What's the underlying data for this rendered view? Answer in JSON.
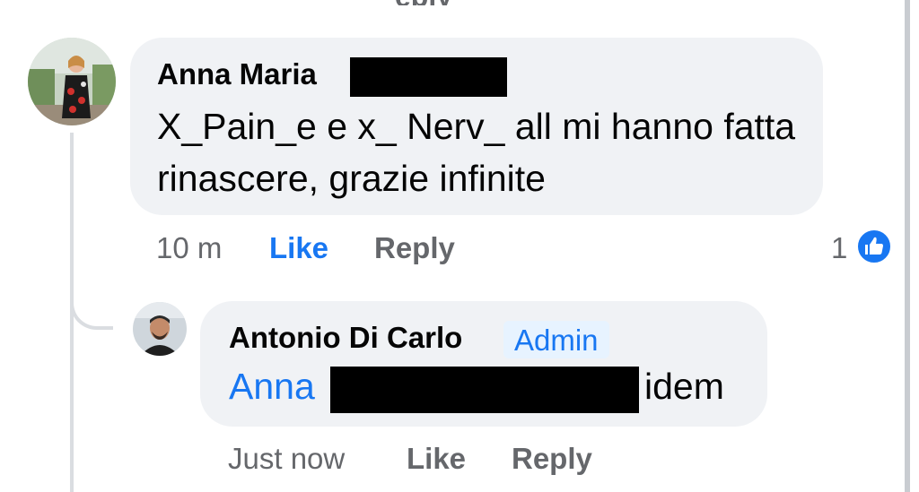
{
  "top_cut_text": "eply",
  "comments": [
    {
      "author": "Anna Maria",
      "text": "X_Pain_e e x_ Nerv_ all mi hanno fatta rinascere, grazie infinite",
      "time": "10 m",
      "like_label": "Like",
      "reply_label": "Reply",
      "reaction_count": "1",
      "reaction_icon": "thumbs-up-icon"
    },
    {
      "author": "Antonio Di Carlo",
      "badge": "Admin",
      "mention": "Anna",
      "text": "idem",
      "time": "Just now",
      "like_label": "Like",
      "reply_label": "Reply"
    }
  ],
  "colors": {
    "bubble": "#f0f2f5",
    "link_blue": "#1877f2",
    "meta_gray": "#65676b",
    "badge_bg": "#e7f3ff"
  }
}
